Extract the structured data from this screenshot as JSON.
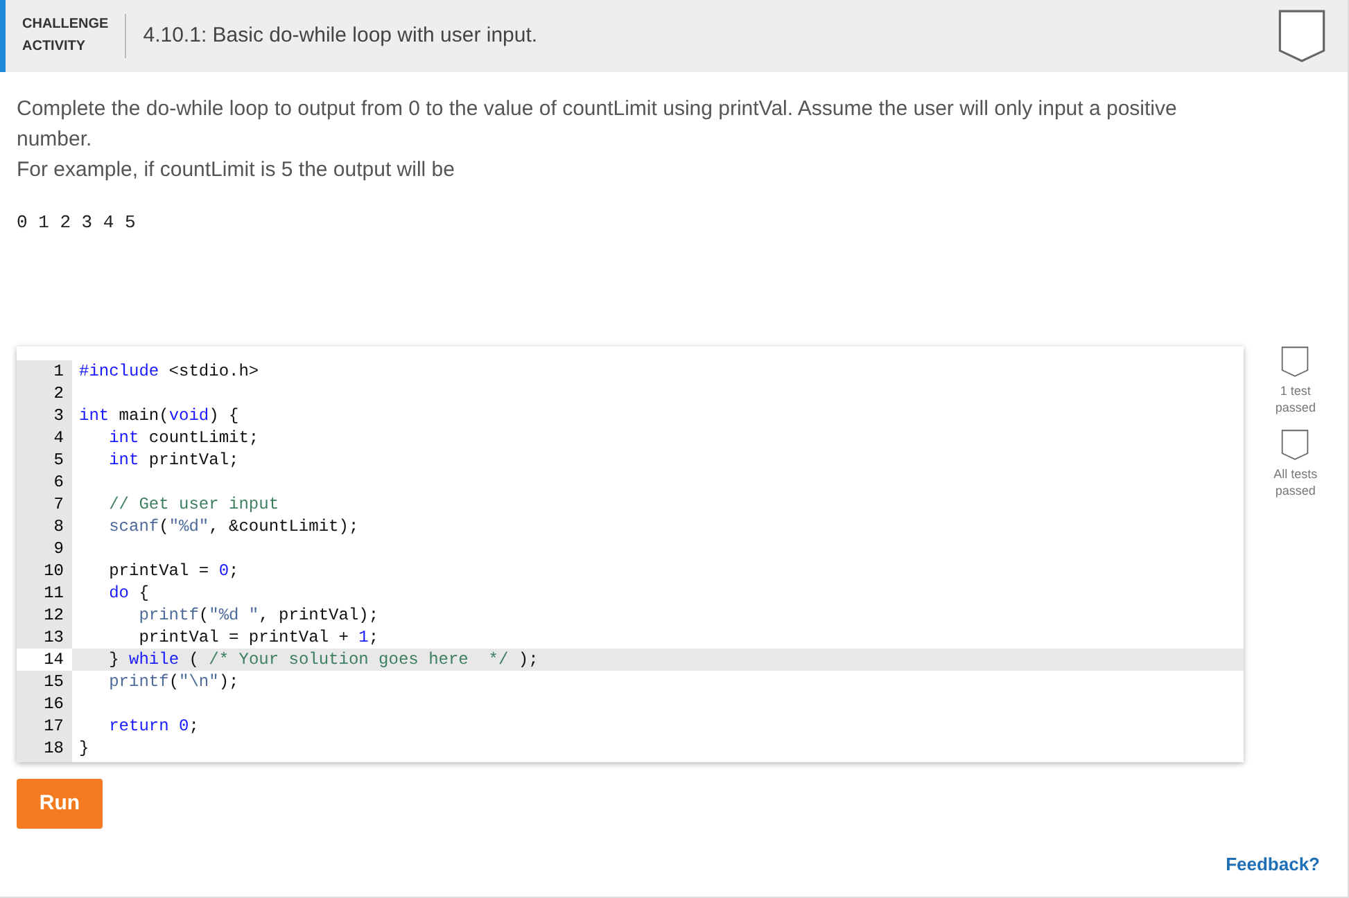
{
  "header": {
    "badge_lines": [
      "CHALLENGE",
      "ACTIVITY"
    ],
    "title": "4.10.1: Basic do-while loop with user input.",
    "completed": false
  },
  "instructions": [
    "Complete the do-while loop to output from 0 to the value of countLimit using printVal. Assume the user will only input a positive number.",
    "For example, if countLimit is 5 the output will be"
  ],
  "example_output": "0 1 2 3 4 5",
  "editor": {
    "lines": [
      {
        "number": "1",
        "active": false,
        "tokens": [
          {
            "kind": "keyword",
            "text": "#include"
          },
          {
            "kind": "plain",
            "text": " <stdio.h>"
          }
        ]
      },
      {
        "number": "2",
        "active": false
      },
      {
        "number": "3",
        "active": false,
        "tokens": [
          {
            "kind": "keyword",
            "text": "int"
          },
          {
            "kind": "plain",
            "text": " main("
          },
          {
            "kind": "keyword",
            "text": "void"
          },
          {
            "kind": "plain",
            "text": ") {"
          }
        ]
      },
      {
        "number": "4",
        "active": false,
        "tokens": [
          {
            "kind": "keyword",
            "text": "   int"
          },
          {
            "kind": "plain",
            "text": " countLimit;"
          }
        ]
      },
      {
        "number": "5",
        "active": false,
        "tokens": [
          {
            "kind": "keyword",
            "text": "   int"
          },
          {
            "kind": "plain",
            "text": " printVal;"
          }
        ]
      },
      {
        "number": "6",
        "active": false
      },
      {
        "number": "7",
        "active": false,
        "tokens": [
          {
            "kind": "comment",
            "text": "   // Get user input"
          }
        ]
      },
      {
        "number": "8",
        "active": false,
        "tokens": [
          {
            "kind": "builtin",
            "text": "   scanf"
          },
          {
            "kind": "plain",
            "text": "("
          },
          {
            "kind": "string",
            "text": "\"%d\""
          },
          {
            "kind": "plain",
            "text": ", &countLimit);"
          }
        ]
      },
      {
        "number": "9",
        "active": false
      },
      {
        "number": "10",
        "active": false,
        "tokens": [
          {
            "kind": "plain",
            "text": "   printVal = "
          },
          {
            "kind": "number",
            "text": "0"
          },
          {
            "kind": "plain",
            "text": ";"
          }
        ]
      },
      {
        "number": "11",
        "active": false,
        "tokens": [
          {
            "kind": "keyword",
            "text": "   do"
          },
          {
            "kind": "plain",
            "text": " {"
          }
        ]
      },
      {
        "number": "12",
        "active": false,
        "tokens": [
          {
            "kind": "builtin",
            "text": "      printf"
          },
          {
            "kind": "plain",
            "text": "("
          },
          {
            "kind": "string",
            "text": "\"%d \""
          },
          {
            "kind": "plain",
            "text": ", printVal);"
          }
        ]
      },
      {
        "number": "13",
        "active": false,
        "tokens": [
          {
            "kind": "plain",
            "text": "      printVal = printVal + "
          },
          {
            "kind": "number",
            "text": "1"
          },
          {
            "kind": "plain",
            "text": ";"
          }
        ]
      },
      {
        "number": "14",
        "active": true,
        "tokens": [
          {
            "kind": "plain",
            "text": "   } "
          },
          {
            "kind": "keyword",
            "text": "while"
          },
          {
            "kind": "plain",
            "text": " ( "
          },
          {
            "kind": "comment",
            "text": "/* Your solution goes here  */"
          },
          {
            "kind": "plain",
            "text": " );"
          }
        ]
      },
      {
        "number": "15",
        "active": false,
        "tokens": [
          {
            "kind": "builtin",
            "text": "   printf"
          },
          {
            "kind": "plain",
            "text": "("
          },
          {
            "kind": "string",
            "text": "\"\\n\""
          },
          {
            "kind": "plain",
            "text": ");"
          }
        ]
      },
      {
        "number": "16",
        "active": false
      },
      {
        "number": "17",
        "active": false,
        "tokens": [
          {
            "kind": "keyword",
            "text": "   return "
          },
          {
            "kind": "number",
            "text": "0"
          },
          {
            "kind": "plain",
            "text": ";"
          }
        ]
      },
      {
        "number": "18",
        "active": false,
        "tokens": [
          {
            "kind": "plain",
            "text": "}"
          }
        ]
      }
    ]
  },
  "tests": [
    {
      "label_lines": [
        "1 test",
        "passed"
      ],
      "passed": false
    },
    {
      "label_lines": [
        "All tests",
        "passed"
      ],
      "passed": false
    }
  ],
  "run_button": "Run",
  "feedback_link": "Feedback?"
}
